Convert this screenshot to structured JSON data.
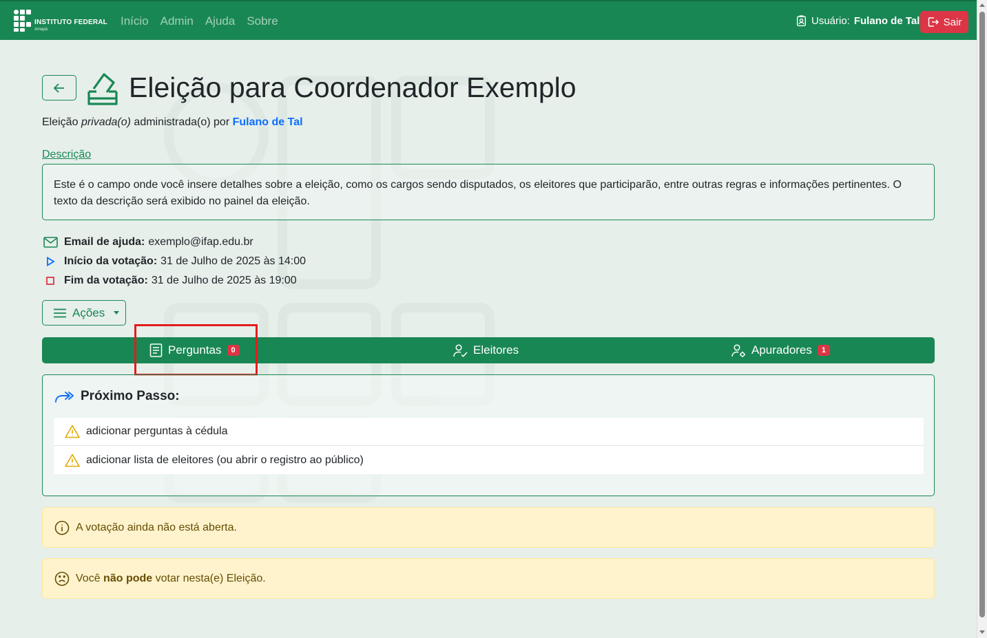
{
  "nav": {
    "logo_title": "INSTITUTO FEDERAL",
    "logo_sub": "Amapá",
    "links": [
      "Início",
      "Admin",
      "Ajuda",
      "Sobre"
    ],
    "user_label": "Usuário:",
    "user_name": "Fulano de Tal",
    "logout": "Sair"
  },
  "page": {
    "title": "Eleição para Coordenador Exemplo",
    "sub_prefix": "Eleição",
    "sub_type": "privada(o)",
    "sub_mid": "administrada(o) por",
    "sub_admin": "Fulano de Tal",
    "desc_link": "Descrição",
    "description": "Este é o campo onde você insere detalhes sobre a eleição, como os cargos sendo disputados, os eleitores que participarão, entre outras regras e informações pertinentes. O texto da descrição será exibido no painel da eleição."
  },
  "info": {
    "email_label": "Email de ajuda:",
    "email_value": "exemplo@ifap.edu.br",
    "start_label": "Início da votação:",
    "start_value": "31 de Julho de 2025 às 14:00",
    "end_label": "Fim da votação:",
    "end_value": "31 de Julho de 2025 às 19:00"
  },
  "actions_label": "Ações",
  "tabs": {
    "questions": "Perguntas",
    "questions_count": "0",
    "voters": "Eleitores",
    "trustees": "Apuradores",
    "trustees_count": "1"
  },
  "next_step": {
    "title": "Próximo Passo:",
    "items": [
      "adicionar perguntas à cédula",
      "adicionar lista de eleitores (ou abrir o registro ao público)"
    ]
  },
  "alerts": {
    "not_open": "A votação ainda não está aberta.",
    "cannot_vote_pre": "Você",
    "cannot_vote_bold": "não pode",
    "cannot_vote_post": "votar nesta(e) Eleição."
  },
  "colors": {
    "brand": "#198754",
    "danger": "#dc3545",
    "link": "#0d6efd",
    "warning_bg": "#fff3cd"
  }
}
